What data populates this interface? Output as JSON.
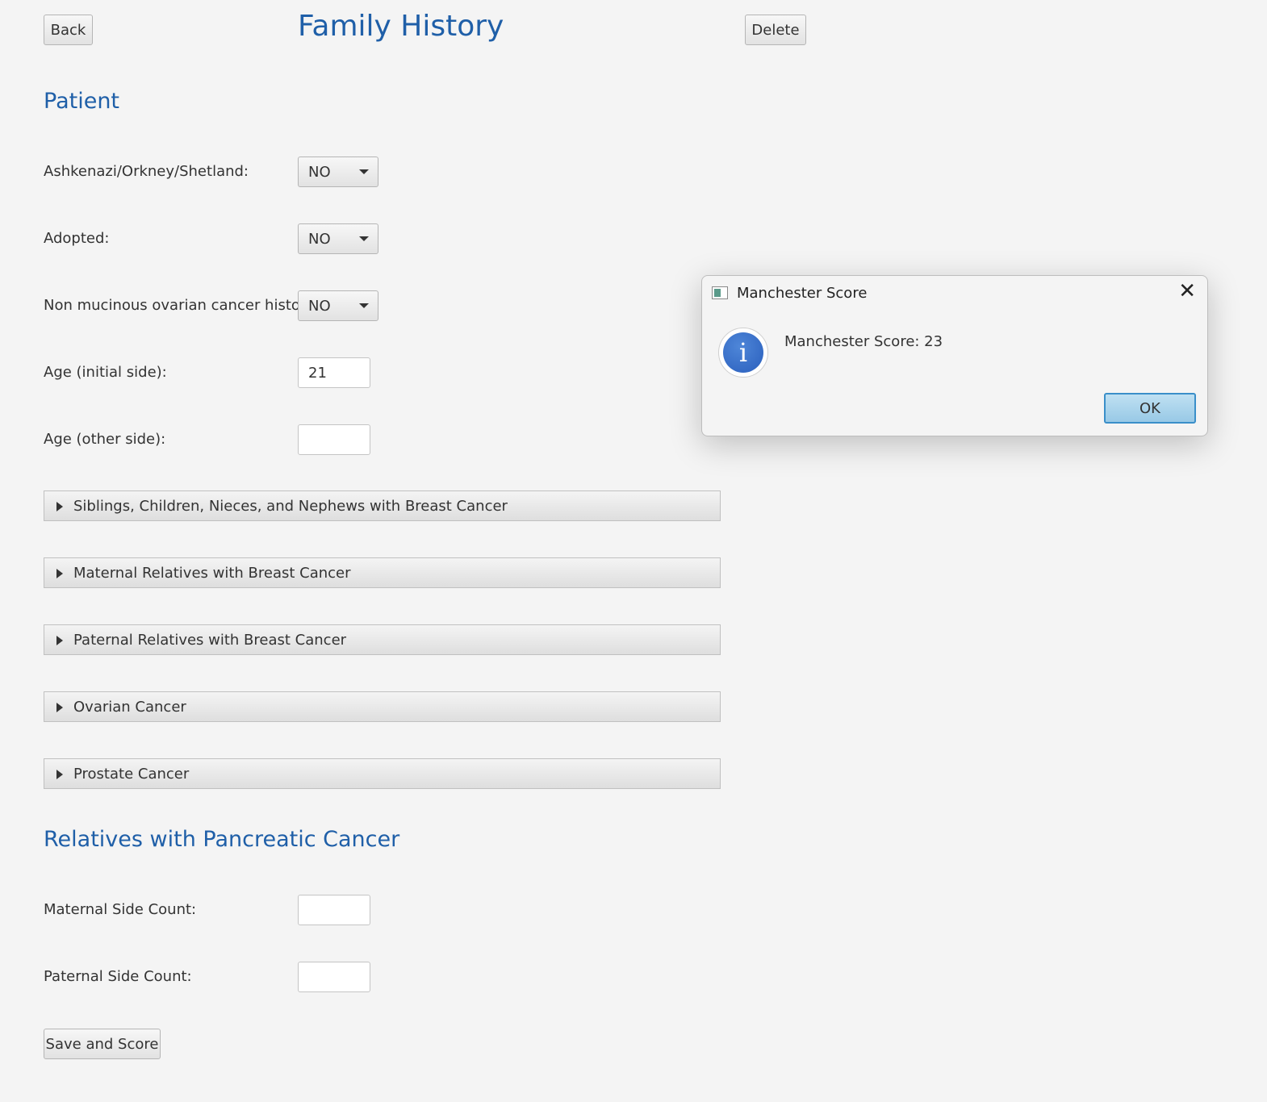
{
  "header": {
    "back_label": "Back",
    "title": "Family History",
    "delete_label": "Delete"
  },
  "patient": {
    "section_title": "Patient",
    "fields": [
      {
        "label": "Ashkenazi/Orkney/Shetland:",
        "type": "combo",
        "value": "NO"
      },
      {
        "label": "Adopted:",
        "type": "combo",
        "value": "NO"
      },
      {
        "label": "Non mucinous ovarian cancer history:",
        "type": "combo",
        "value": "NO"
      },
      {
        "label": "Age (initial side):",
        "type": "text",
        "value": "21"
      },
      {
        "label": "Age (other side):",
        "type": "text",
        "value": ""
      }
    ]
  },
  "accordions": [
    "Siblings, Children, Nieces, and Nephews with Breast Cancer",
    "Maternal Relatives with Breast Cancer",
    "Paternal Relatives with Breast Cancer",
    "Ovarian Cancer",
    "Prostate Cancer"
  ],
  "pancreatic": {
    "section_title": "Relatives with Pancreatic Cancer",
    "maternal_label": "Maternal Side Count:",
    "maternal_value": "",
    "paternal_label": "Paternal Side Count:",
    "paternal_value": ""
  },
  "save_label": "Save and Score",
  "dialog": {
    "title": "Manchester Score",
    "message": "Manchester Score: 23",
    "info_glyph": "i",
    "ok_label": "OK",
    "close_glyph": "✕"
  }
}
